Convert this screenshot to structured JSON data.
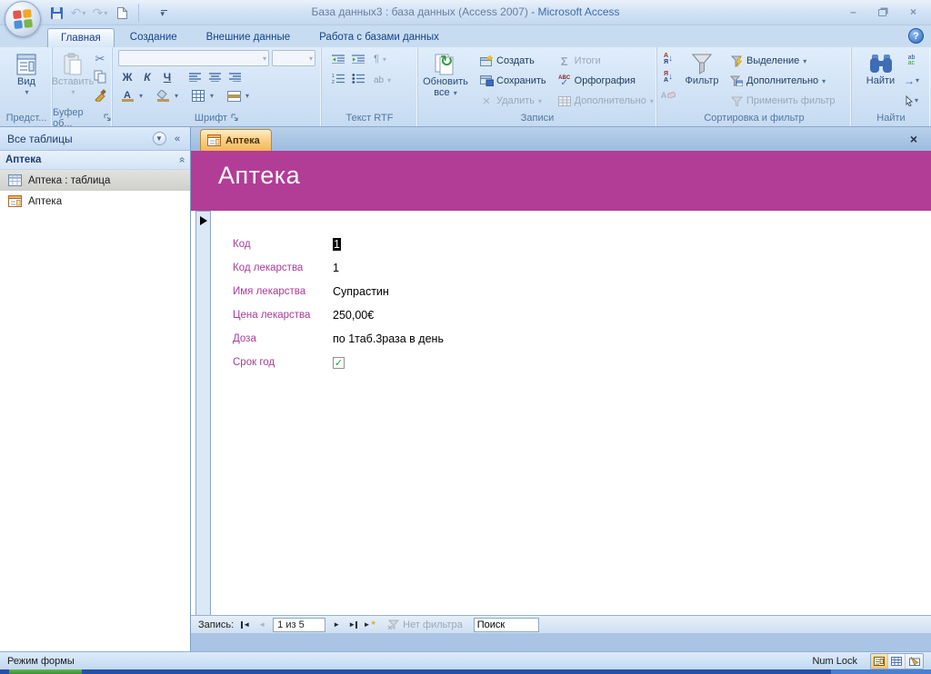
{
  "window": {
    "title_db": "База данных3 : база данных (Access 2007)",
    "title_app": "-  Microsoft Access"
  },
  "tabs": {
    "home": "Главная",
    "create": "Создание",
    "external": "Внешние данные",
    "dbtools": "Работа с базами данных"
  },
  "ribbon": {
    "views": {
      "label": "Вид",
      "caption": "Предст..."
    },
    "clipboard": {
      "paste": "Вставить",
      "caption": "Буфер об..."
    },
    "font": {
      "bold": "Ж",
      "italic": "К",
      "underline": "Ч",
      "color_letter": "А",
      "caption": "Шрифт"
    },
    "richtext": {
      "ab": "ab",
      "caption": "Текст RTF"
    },
    "records": {
      "refresh_line1": "Обновить",
      "refresh_line2": "все",
      "create": "Создать",
      "save": "Сохранить",
      "delete": "Удалить",
      "totals": "Итоги",
      "spelling": "Орфография",
      "more": "Дополнительно",
      "abc": "ABC",
      "caption": "Записи"
    },
    "sort": {
      "a": "А",
      "ya": "Я",
      "filter": "Фильтр",
      "selection": "Выделение",
      "advanced": "Дополнительно",
      "apply": "Применить фильтр",
      "caption": "Сортировка и фильтр"
    },
    "find": {
      "label": "Найти",
      "ab": "ab",
      "ac": "ac",
      "caption": "Найти"
    }
  },
  "nav": {
    "title": "Все таблицы",
    "group": "Аптека",
    "items": [
      {
        "label": "Аптека : таблица"
      },
      {
        "label": "Аптека"
      }
    ]
  },
  "doc": {
    "tab": "Аптека",
    "title": "Аптека",
    "fields": [
      {
        "label": "Код",
        "value": "1"
      },
      {
        "label": "Код лекарства",
        "value": "1"
      },
      {
        "label": "Имя лекарства",
        "value": "Супрастин"
      },
      {
        "label": "Цена лекарства",
        "value": "250,00€"
      },
      {
        "label": "Доза",
        "value": "по 1таб.3раза в день"
      },
      {
        "label": "Срок год",
        "value": ""
      }
    ],
    "recnav": {
      "label": "Запись:",
      "position": "1 из 5",
      "nofilter": "Нет фильтра",
      "search": "Поиск"
    }
  },
  "status": {
    "mode": "Режим формы",
    "numlock": "Num Lock"
  },
  "icons": {
    "scissors": "✂",
    "sigma": "Σ",
    "pilcrow": "¶",
    "check": "✓",
    "close_doc": "×",
    "minimize": "–",
    "close_win": "×",
    "help": "?",
    "caret_down": "▾",
    "collapse": "«",
    "chev_double": "»",
    "nav_prev": "◄",
    "nav_next": "►",
    "star": "*",
    "undo": "↶",
    "redo": "↷",
    "refresh": "↻",
    "arrow_right": "→"
  },
  "colors": {
    "header_magenta": "#b23d96",
    "label_magenta": "#aa3a98",
    "tab_orange": "#f5b65b",
    "accent_hover": "#fde2a9"
  }
}
